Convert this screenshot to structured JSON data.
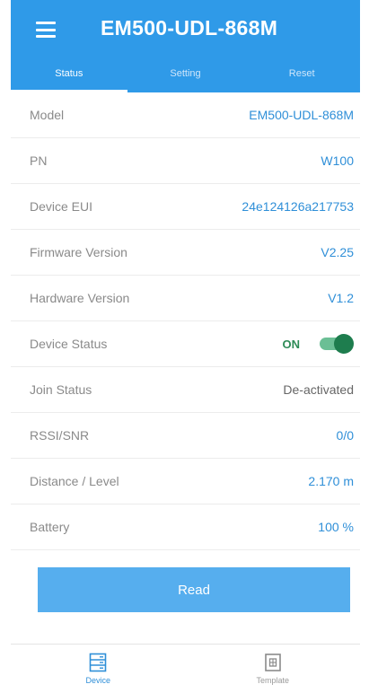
{
  "header": {
    "title": "EM500-UDL-868M",
    "tabs": [
      {
        "label": "Status",
        "active": true
      },
      {
        "label": "Setting",
        "active": false
      },
      {
        "label": "Reset",
        "active": false
      }
    ]
  },
  "rows": [
    {
      "label": "Model",
      "value": "EM500-UDL-868M"
    },
    {
      "label": "PN",
      "value": "W100"
    },
    {
      "label": "Device EUI",
      "value": "24e124126a217753"
    },
    {
      "label": "Firmware Version",
      "value": "V2.25"
    },
    {
      "label": "Hardware Version",
      "value": "V1.2"
    },
    {
      "label": "Device Status",
      "value": "ON",
      "toggle_on": true
    },
    {
      "label": "Join Status",
      "value": "De-activated"
    },
    {
      "label": "RSSI/SNR",
      "value": "0/0"
    },
    {
      "label": "Distance / Level",
      "value": "2.170 m"
    },
    {
      "label": "Battery",
      "value": "100 %"
    }
  ],
  "read_button": {
    "label": "Read"
  },
  "bottom_nav": [
    {
      "label": "Device",
      "icon": "device-icon",
      "active": true
    },
    {
      "label": "Template",
      "icon": "template-icon",
      "active": false
    }
  ],
  "colors": {
    "header_bg": "#2f9ae8",
    "accent_blue": "#2f8fd8",
    "button_bg": "#56aeee",
    "status_green": "#1e7d4e"
  }
}
